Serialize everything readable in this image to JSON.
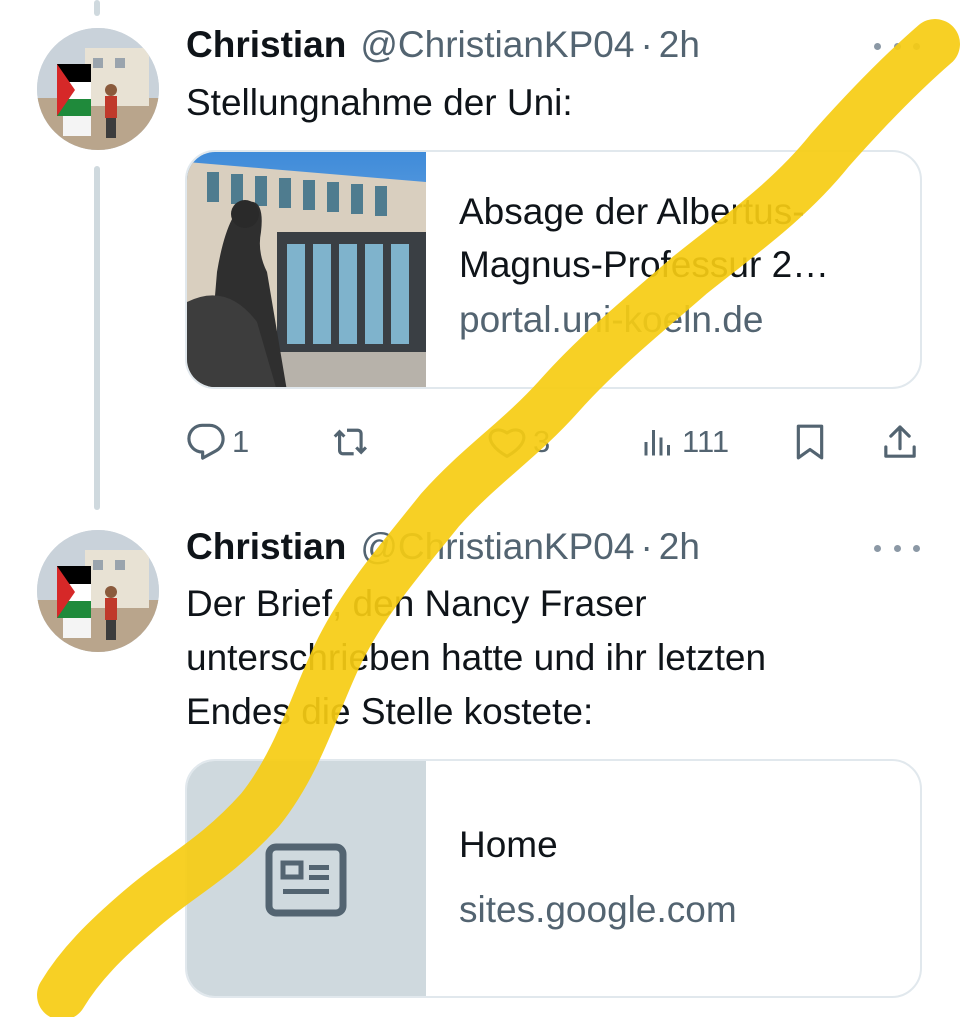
{
  "tweets": [
    {
      "author_name": "Christian",
      "handle": "@ChristianKP04",
      "separator": "·",
      "time": "2h",
      "text_lines": [
        "Stellungnahme der Uni:"
      ],
      "card": {
        "title_lines": [
          "Absage der Albertus-",
          "Magnus-Professur 2…"
        ],
        "domain": "portal.uni-koeln.de"
      },
      "actions": {
        "replies": "1",
        "retweets": "",
        "likes": "3",
        "views": "111"
      }
    },
    {
      "author_name": "Christian",
      "handle": "@ChristianKP04",
      "separator": "·",
      "time": "2h",
      "text_lines": [
        "Der Brief, den Nancy Fraser",
        "unterschrieben hatte und ihr letzten",
        "Endes die Stelle kostete:"
      ],
      "card": {
        "title": "Home",
        "domain": "sites.google.com"
      }
    }
  ],
  "colors": {
    "text_primary": "#0f1419",
    "text_secondary": "#536471",
    "border": "#e1e8ed",
    "thread_line": "#cfd9de",
    "placeholder_bg": "#cfd9de",
    "highlighter": "#f6cc12"
  },
  "icons": [
    "reply-icon",
    "retweet-icon",
    "like-icon",
    "views-icon",
    "bookmark-icon",
    "share-icon",
    "article-icon",
    "more-icon"
  ]
}
